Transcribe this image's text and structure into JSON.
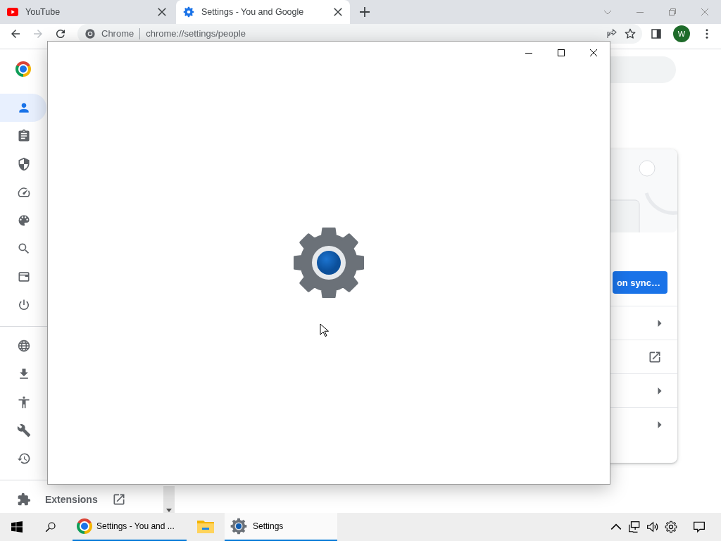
{
  "tabs": [
    {
      "title": "YouTube",
      "selected": false
    },
    {
      "title": "Settings - You and Google",
      "selected": true
    }
  ],
  "address_bar": {
    "origin": "Chrome",
    "url": "chrome://settings/people"
  },
  "profile": {
    "initial": "W"
  },
  "sidebar": {
    "groups": [
      {
        "items": [
          {
            "selected": true
          },
          {
            "selected": false
          },
          {
            "selected": false
          },
          {
            "selected": false
          },
          {
            "selected": false
          },
          {
            "selected": false
          },
          {
            "selected": false
          },
          {
            "selected": false
          }
        ]
      },
      {
        "items": [
          {
            "selected": false
          },
          {
            "selected": false
          },
          {
            "selected": false
          },
          {
            "selected": false
          },
          {
            "selected": false
          }
        ]
      }
    ],
    "extensions": {
      "label": "Extensions"
    }
  },
  "sync_card": {
    "button": "on sync…",
    "rows": [
      {
        "kind": "arrow"
      },
      {
        "kind": "external"
      },
      {
        "kind": "arrow"
      },
      {
        "kind": "arrow"
      }
    ]
  },
  "taskbar": {
    "apps": [
      {
        "kind": "chrome",
        "label": "Settings - You and ...",
        "running": true,
        "selected": false
      },
      {
        "kind": "explorer",
        "running": false,
        "selected": false
      },
      {
        "kind": "settings",
        "label": "Settings",
        "running": true,
        "selected": true
      }
    ]
  }
}
